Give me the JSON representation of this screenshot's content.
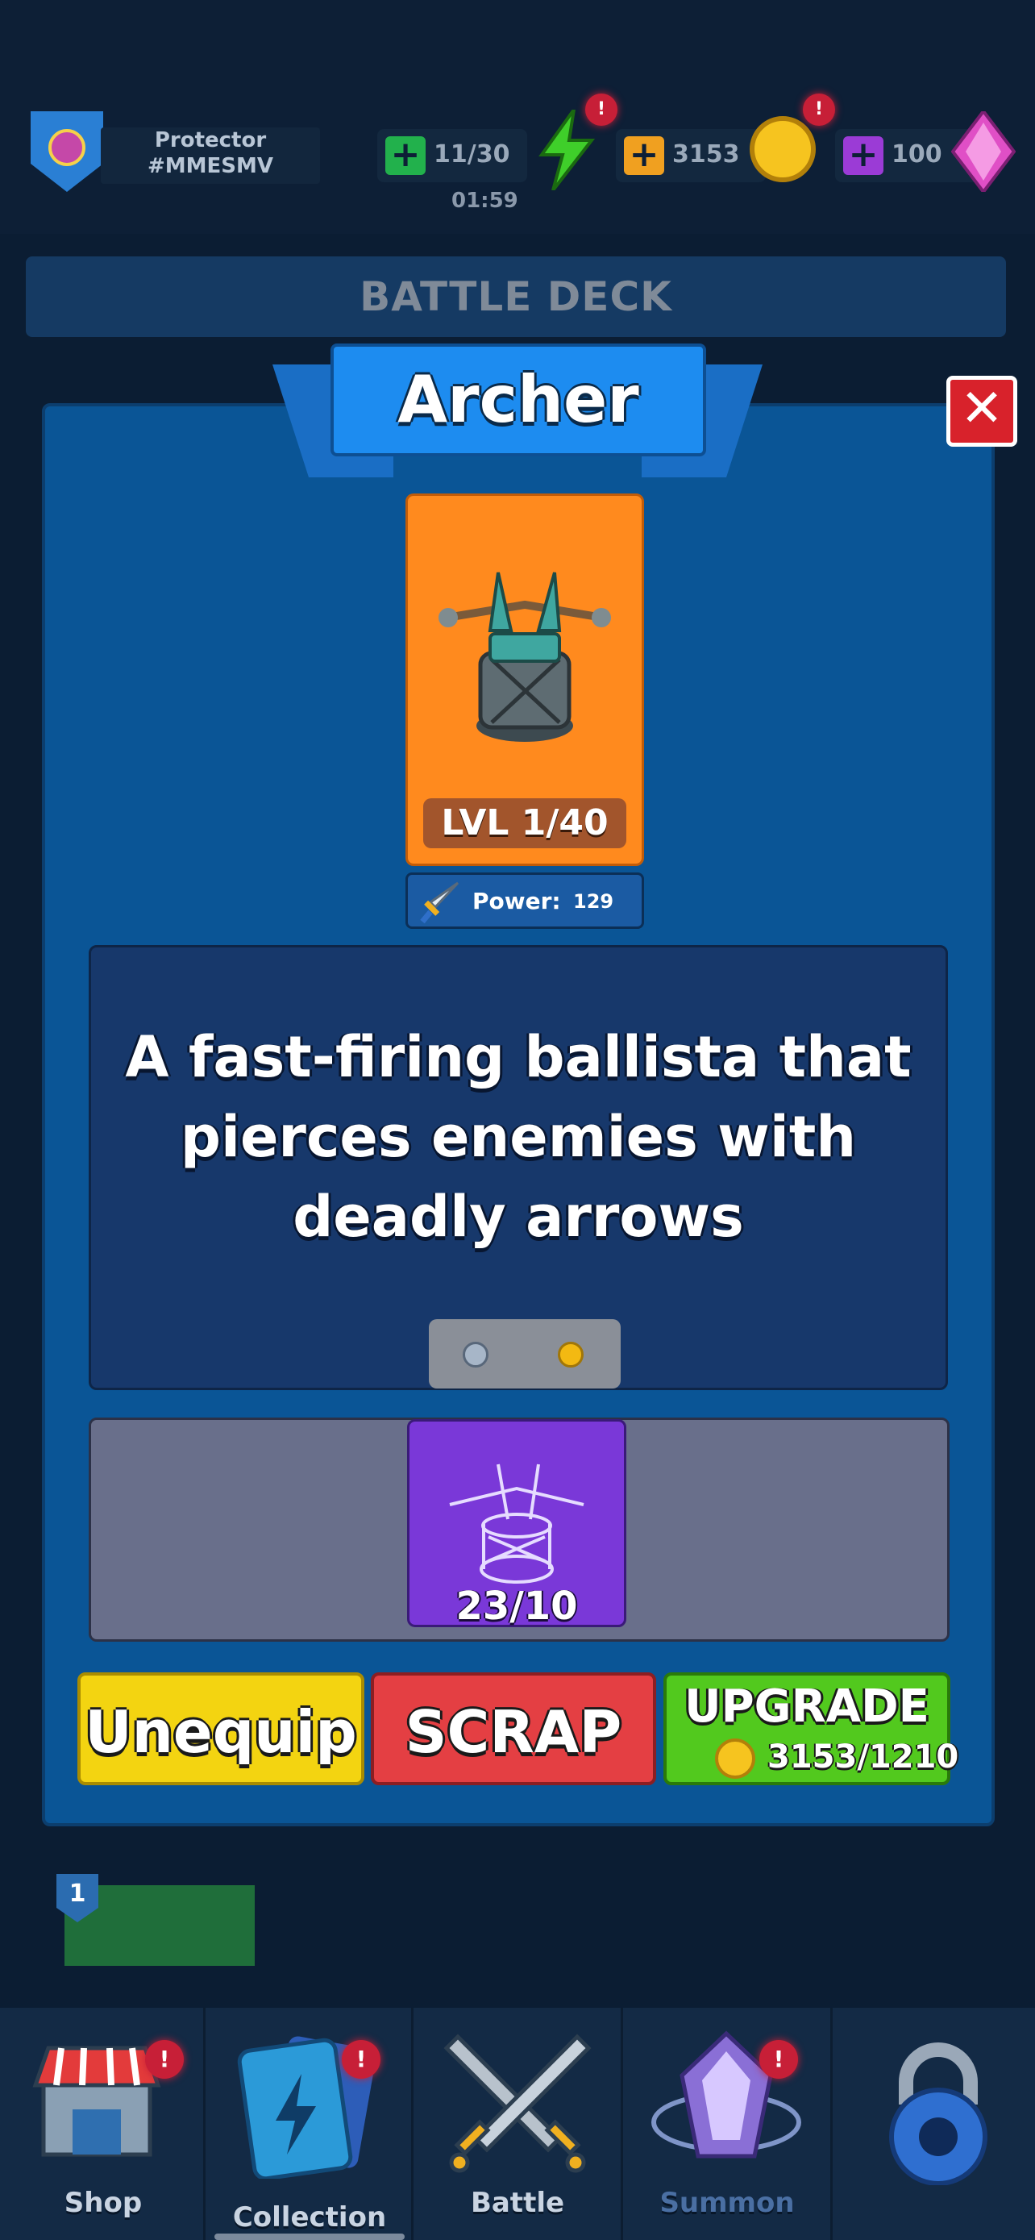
{
  "hud": {
    "player_name": "Protector",
    "player_tag": "#MMESMV",
    "energy": "11/30",
    "energy_timer": "01:59",
    "coins": "3153",
    "gems": "100",
    "alert": "!",
    "colors": {
      "energy": "#22b14c",
      "coins": "#f0a020",
      "gems": "#9b3bd6"
    }
  },
  "header": {
    "title": "BATTLE DECK"
  },
  "modal": {
    "title": "Archer",
    "level": "LVL 1/40",
    "power_label": "Power:",
    "power_value": "129",
    "description": "A fast-firing ballista that pierces enemies with deadly arrows",
    "pager": {
      "pages": 2,
      "active": 2
    },
    "shard_count": "23/10",
    "buttons": {
      "unequip": "Unequip",
      "scrap": "SCRAP",
      "upgrade": "UPGRADE",
      "upgrade_cost": "3153/1210"
    }
  },
  "deck_slot": {
    "level": "1"
  },
  "nav": {
    "items": [
      {
        "label": "Shop",
        "icon": "shop-icon",
        "alert": "!"
      },
      {
        "label": "Collection",
        "icon": "collection-icon",
        "alert": "!"
      },
      {
        "label": "Battle",
        "icon": "battle-icon"
      },
      {
        "label": "Summon",
        "icon": "summon-icon",
        "alert": "!"
      },
      {
        "label": "",
        "icon": "lock-icon"
      }
    ]
  }
}
